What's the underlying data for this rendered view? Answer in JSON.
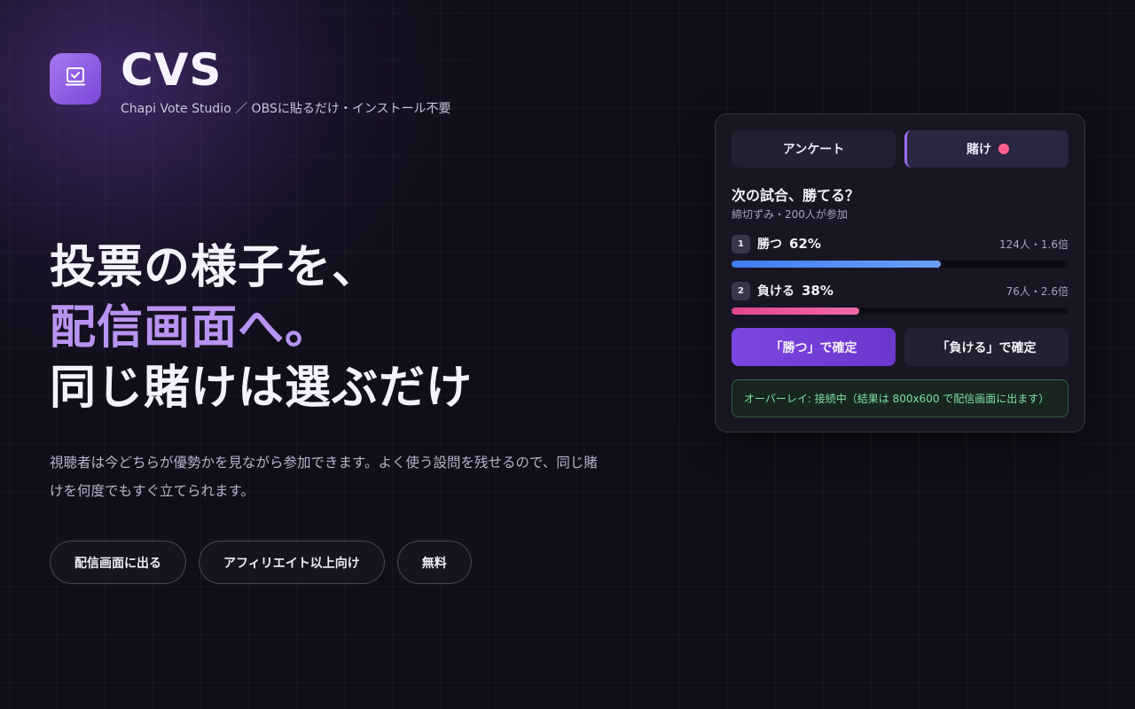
{
  "brand": {
    "name": "CVS",
    "subtitle": "Chapi Vote Studio ／ OBSに貼るだけ・インストール不要",
    "logo_icon": "checkbox-icon",
    "accent_color": "#9c6cf0"
  },
  "hero": {
    "line1": "投票の様子を、",
    "line2": "配信画面へ。",
    "line3": "同じ賭けは選ぶだけ"
  },
  "description": "視聴者は今どちらが優勢かを見ながら参加できます。よく使う設問を残せるので、同じ賭けを何度でもすぐ立てられます。",
  "tags": [
    "配信画面に出る",
    "アフィリエイト以上向け",
    "無料"
  ],
  "card": {
    "tabs": {
      "survey_label": "アンケート",
      "bet_label": "賭け",
      "active": "bet",
      "bet_indicator_color": "#ff5f8f"
    },
    "question": {
      "title": "次の試合、勝てる？",
      "meta": "締切ずみ・200人が参加"
    },
    "options": [
      {
        "number": "1",
        "label": "勝つ",
        "percent": "62%",
        "stats": "124人・1.6倍",
        "fraction": 0.62,
        "color": "#3f7df0"
      },
      {
        "number": "2",
        "label": "負ける",
        "percent": "38%",
        "stats": "76人・2.6倍",
        "fraction": 0.38,
        "color": "#e0478d"
      }
    ],
    "actions": {
      "confirm_win": "「勝つ」で確定",
      "confirm_lose": "「負ける」で確定"
    },
    "status": "オーバーレイ: 接続中（結果は 800x600 で配信画面に出ます）",
    "status_color": "#7fe0a4"
  }
}
